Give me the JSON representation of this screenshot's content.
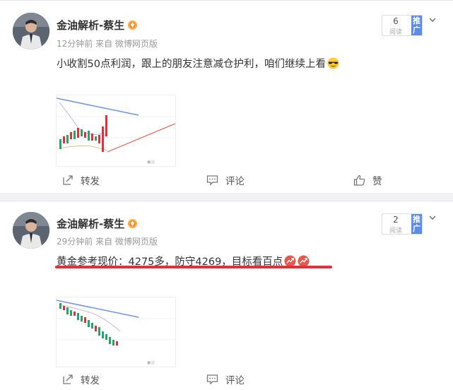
{
  "posts": [
    {
      "author": "金油解析-蔡生",
      "meta": "12分钟前 来自 微博网页版",
      "text": "小收割50点利润，跟上的朋友注意减仓护利，咱们继续上看",
      "read_count": "6",
      "read_label": "阅读",
      "promote_label": "推广",
      "actions": {
        "repost": "转发",
        "comment": "评论",
        "like": "赞"
      }
    },
    {
      "author": "金油解析-蔡生",
      "meta": "29分钟前 来自 微博网页版",
      "text": "黄金参考现价：4275多，防守4269，目标看百点",
      "read_count": "2",
      "read_label": "阅读",
      "promote_label": "推广",
      "actions": {
        "repost": "转发",
        "comment": "评论"
      }
    }
  ],
  "colors": {
    "accent_blue": "#5b8de8",
    "highlight_red": "#e0323a",
    "candle_red": "#e0323a",
    "candle_green": "#2aa36a"
  },
  "icons": [
    "vip-badge-icon",
    "more-chevron-icon",
    "repost-icon",
    "comment-icon",
    "like-icon",
    "sunglasses-emoji-icon",
    "trend-up-icon"
  ]
}
